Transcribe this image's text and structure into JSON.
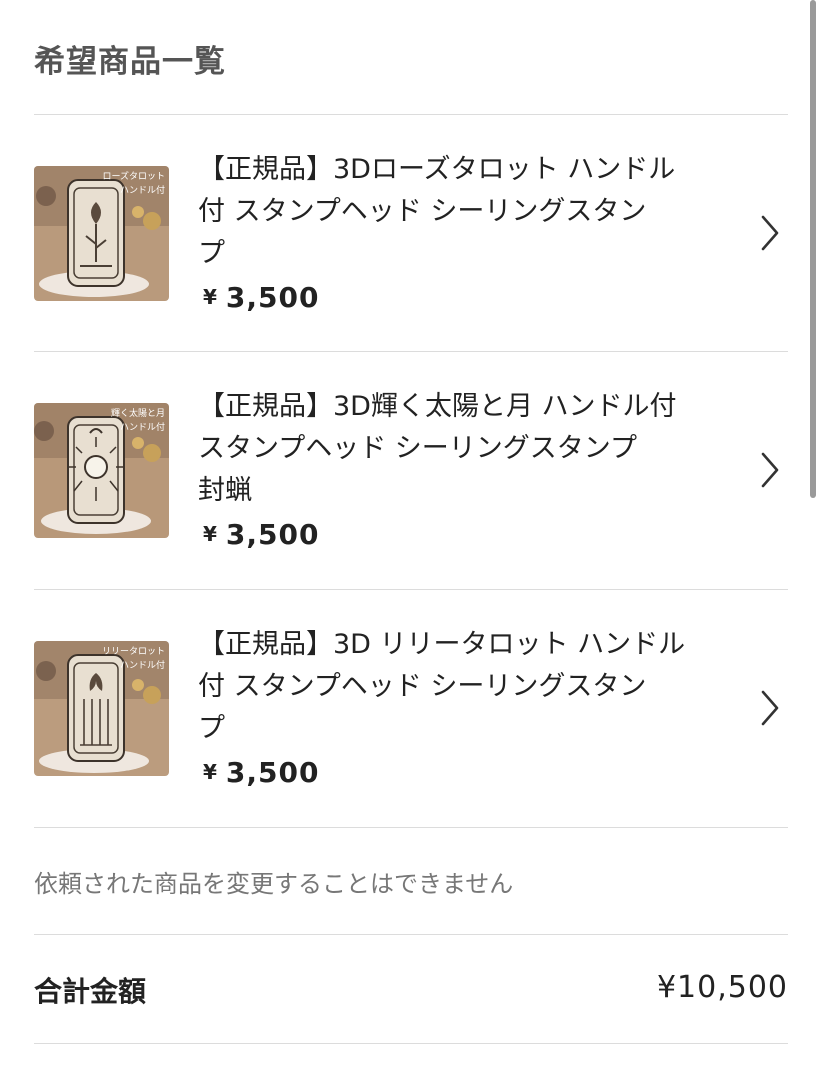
{
  "header": {
    "title": "希望商品一覧"
  },
  "items": [
    {
      "title_lines": [
        "【正規品】3Dローズタロット ハンドル",
        "付 スタンプヘッド シーリングスタン",
        "プ"
      ],
      "price": "3,500",
      "currency": "¥",
      "thumb_caption": [
        "ローズタロット",
        "ハンドル付"
      ]
    },
    {
      "title_lines": [
        "【正規品】3D輝く太陽と月 ハンドル付",
        "スタンプヘッド シーリングスタンプ",
        "封蝋"
      ],
      "price": "3,500",
      "currency": "¥",
      "thumb_caption": [
        "輝く太陽と月",
        "ハンドル付"
      ]
    },
    {
      "title_lines": [
        "【正規品】3D リリータロット ハンドル",
        "付 スタンプヘッド シーリングスタン",
        "プ"
      ],
      "price": "3,500",
      "currency": "¥",
      "thumb_caption": [
        "リリータロット",
        "ハンドル付"
      ]
    }
  ],
  "notice": "依頼された商品を変更することはできません",
  "summary": {
    "total_label": "合計金額",
    "total_value": "¥10,500"
  },
  "icons": {
    "row_arrow": "chevron-right-icon"
  },
  "colors": {
    "divider": "#dcdcdc",
    "title_gray": "#555555",
    "notice_gray": "#777777"
  }
}
